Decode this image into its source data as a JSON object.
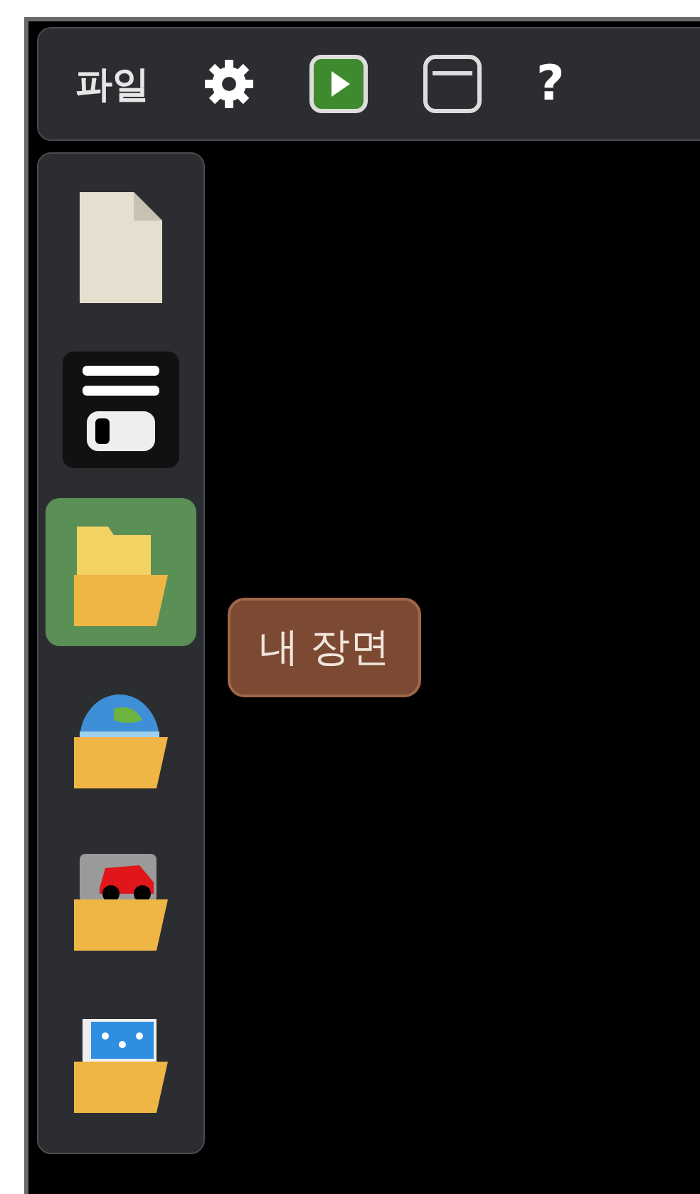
{
  "toolbar": {
    "menu": "파일",
    "buttons": [
      {
        "kind": "settings"
      },
      {
        "kind": "play"
      },
      {
        "kind": "window"
      }
    ],
    "help": "?"
  },
  "sidebar": {
    "items": [
      {
        "kind": "new-file",
        "selected": false
      },
      {
        "kind": "save",
        "selected": false
      },
      {
        "kind": "folder",
        "selected": true,
        "tooltip": "내 장면"
      },
      {
        "kind": "globe-folder",
        "selected": false
      },
      {
        "kind": "car-folder",
        "selected": false
      },
      {
        "kind": "picture-folder",
        "selected": false
      }
    ]
  }
}
